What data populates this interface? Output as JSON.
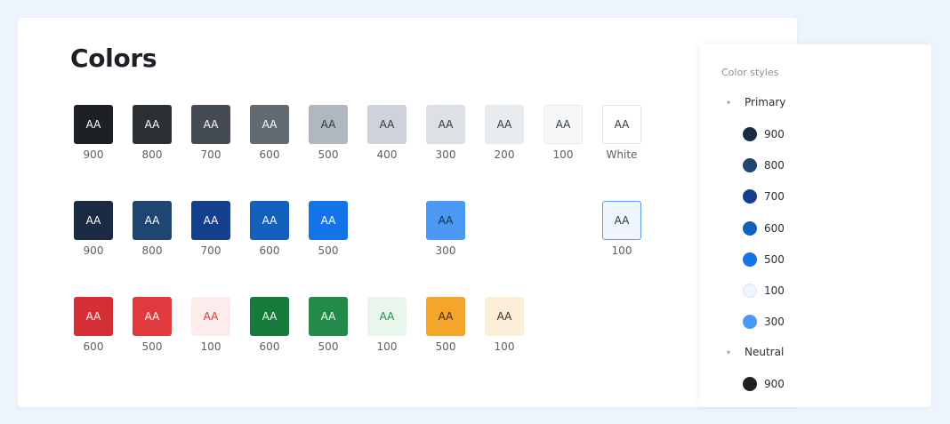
{
  "page": {
    "title": "Colors"
  },
  "rows": [
    {
      "swatches": [
        {
          "label": "900",
          "fill": "#1d2125",
          "text_color": "#ffffff",
          "border": "none",
          "col": 0
        },
        {
          "label": "800",
          "fill": "#2c3034",
          "text_color": "#ffffff",
          "border": "none",
          "col": 1
        },
        {
          "label": "700",
          "fill": "#454b52",
          "text_color": "#ffffff",
          "border": "none",
          "col": 2
        },
        {
          "label": "600",
          "fill": "#626a72",
          "text_color": "#ffffff",
          "border": "none",
          "col": 3
        },
        {
          "label": "500",
          "fill": "#b0b7bf",
          "text_color": "#33383d",
          "border": "none",
          "col": 4
        },
        {
          "label": "400",
          "fill": "#ced3da",
          "text_color": "#33383d",
          "border": "none",
          "col": 5
        },
        {
          "label": "300",
          "fill": "#dde1e6",
          "text_color": "#33383d",
          "border": "none",
          "col": 6
        },
        {
          "label": "200",
          "fill": "#e9ecef",
          "text_color": "#33383d",
          "border": "none",
          "col": 7
        },
        {
          "label": "100",
          "fill": "#f6f7f9",
          "text_color": "#33383d",
          "border": "1px solid #e7e9ec",
          "col": 8
        },
        {
          "label": "White",
          "fill": "#ffffff",
          "text_color": "#33383d",
          "border": "1px solid #e1e4e8",
          "col": 9
        }
      ]
    },
    {
      "swatches": [
        {
          "label": "900",
          "fill": "#1b2b41",
          "text_color": "#ffffff",
          "border": "none",
          "col": 0
        },
        {
          "label": "800",
          "fill": "#1f4572",
          "text_color": "#ffffff",
          "border": "none",
          "col": 1
        },
        {
          "label": "700",
          "fill": "#133f8d",
          "text_color": "#ffffff",
          "border": "none",
          "col": 2
        },
        {
          "label": "600",
          "fill": "#1360bd",
          "text_color": "#ffffff",
          "border": "none",
          "col": 3
        },
        {
          "label": "500",
          "fill": "#1473e6",
          "text_color": "#ffffff",
          "border": "none",
          "col": 4
        },
        {
          "label": "300",
          "fill": "#4a9af5",
          "text_color": "#1d2b40",
          "border": "none",
          "col": 6
        },
        {
          "label": "100",
          "fill": "#eef5fd",
          "text_color": "#33383d",
          "border": "1px solid #5b9ce8",
          "col": 9
        }
      ]
    },
    {
      "swatches": [
        {
          "label": "600",
          "fill": "#d42f36",
          "text_color": "#ffffff",
          "border": "none",
          "col": 0
        },
        {
          "label": "500",
          "fill": "#e0393e",
          "text_color": "#ffffff",
          "border": "none",
          "col": 1
        },
        {
          "label": "100",
          "fill": "#fdecec",
          "text_color": "#d5393e",
          "border": "none",
          "col": 2
        },
        {
          "label": "600",
          "fill": "#167a3a",
          "text_color": "#ffffff",
          "border": "none",
          "col": 3
        },
        {
          "label": "500",
          "fill": "#238b4a",
          "text_color": "#ffffff",
          "border": "none",
          "col": 4
        },
        {
          "label": "100",
          "fill": "#e9f6ec",
          "text_color": "#238b4a",
          "border": "none",
          "col": 5
        },
        {
          "label": "500",
          "fill": "#f4a52c",
          "text_color": "#3a2a10",
          "border": "none",
          "col": 6
        },
        {
          "label": "100",
          "fill": "#fdeeda",
          "text_color": "#3a3020",
          "border": "none",
          "col": 7
        }
      ]
    }
  ],
  "side_panel": {
    "title": "Color styles",
    "groups": [
      {
        "name": "Primary",
        "items": [
          {
            "label": "900",
            "color": "#1b2b41",
            "border": "none"
          },
          {
            "label": "800",
            "color": "#1f4572",
            "border": "none"
          },
          {
            "label": "700",
            "color": "#133f8d",
            "border": "none"
          },
          {
            "label": "600",
            "color": "#1360bd",
            "border": "none"
          },
          {
            "label": "500",
            "color": "#1473e6",
            "border": "none"
          },
          {
            "label": "100",
            "color": "#eef5fd",
            "border": "1px solid #d6e4f5"
          },
          {
            "label": "300",
            "color": "#4a9af5",
            "border": "none"
          }
        ]
      },
      {
        "name": "Neutral",
        "items": [
          {
            "label": "900",
            "color": "#1d2125",
            "border": "none"
          }
        ]
      }
    ]
  }
}
